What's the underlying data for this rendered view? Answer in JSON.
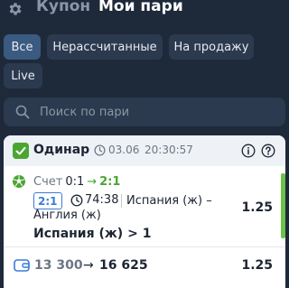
{
  "header": {
    "tab_coupon": "Купон",
    "tab_my_bets": "Мои пари"
  },
  "filters": {
    "all": "Все",
    "unsettled": "Нерассчитанные",
    "for_sale": "На продажу",
    "live": "Live",
    "active": "all"
  },
  "search": {
    "placeholder": "Поиск по пари"
  },
  "bet": {
    "type": "Одинар",
    "date": "03.06",
    "time": "20:30:57",
    "event": {
      "score_prefix": "Счет",
      "score_old": "0:1",
      "score_arrow": "→",
      "score_new": "2:1",
      "score_badge": "2:1",
      "match_time": "74:38",
      "match_name_line1": "Испания (ж) –",
      "match_name_line2": "Англия (ж)",
      "selection": "Испания (ж) > 1",
      "odd": "1.25"
    },
    "stake": "13 300",
    "payout_arrow": "→",
    "payout": "16 625",
    "total_odd": "1.25"
  },
  "colors": {
    "background": "#1e2a3a",
    "chip": "#2b3a4e",
    "chip_active": "#3a5a80",
    "accent_green": "#4aa632",
    "accent_blue": "#3a7bd5"
  },
  "icons": {
    "settings": "gear-icon",
    "search": "search-icon",
    "status": "check-icon",
    "datetime": "clock-icon",
    "info": "info-icon",
    "help": "help-icon",
    "sport": "football-icon",
    "live_time": "clock-icon",
    "wallet": "wallet-icon"
  }
}
